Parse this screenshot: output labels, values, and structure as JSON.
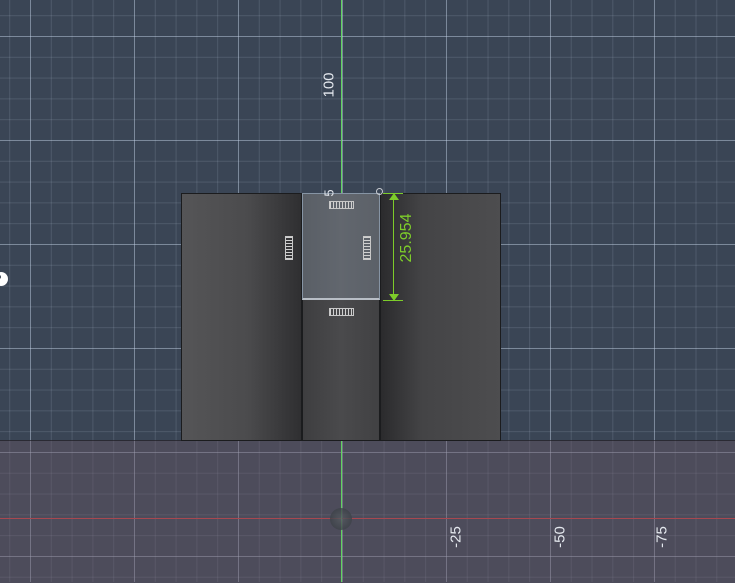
{
  "viewport": {
    "background": "#3a4555",
    "grid": "on",
    "axes": {
      "vertical_axis_color": "#5fd45f",
      "horizontal_axis_color": "#a84850"
    }
  },
  "axis_labels": {
    "vertical_top": "100",
    "vertical_partial": "5",
    "horizontal_1": "-25",
    "horizontal_2": "-50",
    "horizontal_3": "-75"
  },
  "dimension": {
    "value": "25.954",
    "color": "#7dcc2a"
  },
  "model": {
    "face_color": "#4a4a4c",
    "selected_face_highlight": "#b8bec6"
  },
  "icons": {
    "constraint_glyph": "parallel-constraint-icon",
    "origin": "origin-marker-icon",
    "dimension_handle": "dimension-handle-icon",
    "edge_widget": "view-control-icon"
  }
}
